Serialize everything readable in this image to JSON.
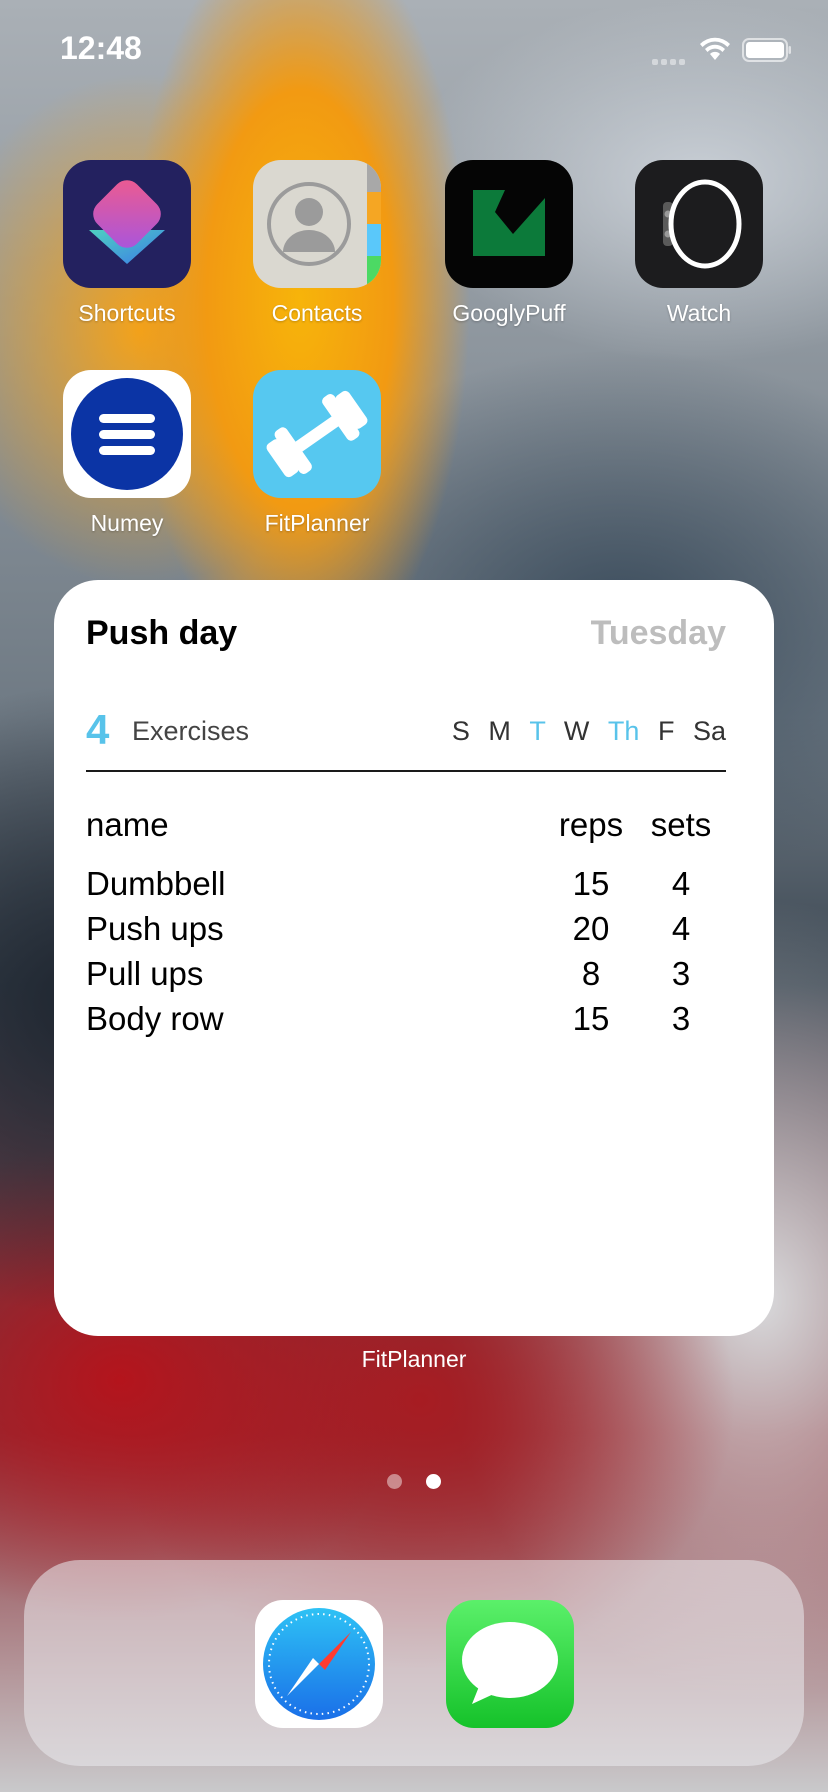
{
  "status_bar": {
    "time": "12:48",
    "signal_icon": "cellular-signal-icon",
    "wifi_icon": "wifi-icon",
    "battery_icon": "battery-icon"
  },
  "apps": [
    {
      "name": "Shortcuts",
      "icon": "shortcuts-icon"
    },
    {
      "name": "Contacts",
      "icon": "contacts-icon"
    },
    {
      "name": "GooglyPuff",
      "icon": "googlypuff-icon"
    },
    {
      "name": "Watch",
      "icon": "watch-icon"
    },
    {
      "name": "Numey",
      "icon": "numey-icon"
    },
    {
      "name": "FitPlanner",
      "icon": "dumbbell-icon"
    }
  ],
  "widget": {
    "title": "Push day",
    "day": "Tuesday",
    "exercise_count": "4",
    "exercise_label": "Exercises",
    "week": [
      {
        "label": "S",
        "active": false
      },
      {
        "label": "M",
        "active": false
      },
      {
        "label": "T",
        "active": true
      },
      {
        "label": "W",
        "active": false
      },
      {
        "label": "Th",
        "active": true
      },
      {
        "label": "F",
        "active": false
      },
      {
        "label": "Sa",
        "active": false
      }
    ],
    "columns": {
      "name": "name",
      "reps": "reps",
      "sets": "sets"
    },
    "rows": [
      {
        "name": "Dumbbell",
        "reps": "15",
        "sets": "4"
      },
      {
        "name": "Push ups",
        "reps": "20",
        "sets": "4"
      },
      {
        "name": "Pull ups",
        "reps": "8",
        "sets": "3"
      },
      {
        "name": "Body row",
        "reps": "15",
        "sets": "3"
      }
    ],
    "caption": "FitPlanner",
    "accent_color": "#58c3ea"
  },
  "page_indicator": {
    "total": 2,
    "current": 2
  },
  "dock": [
    {
      "icon": "safari-icon"
    },
    {
      "icon": "messages-icon"
    }
  ]
}
